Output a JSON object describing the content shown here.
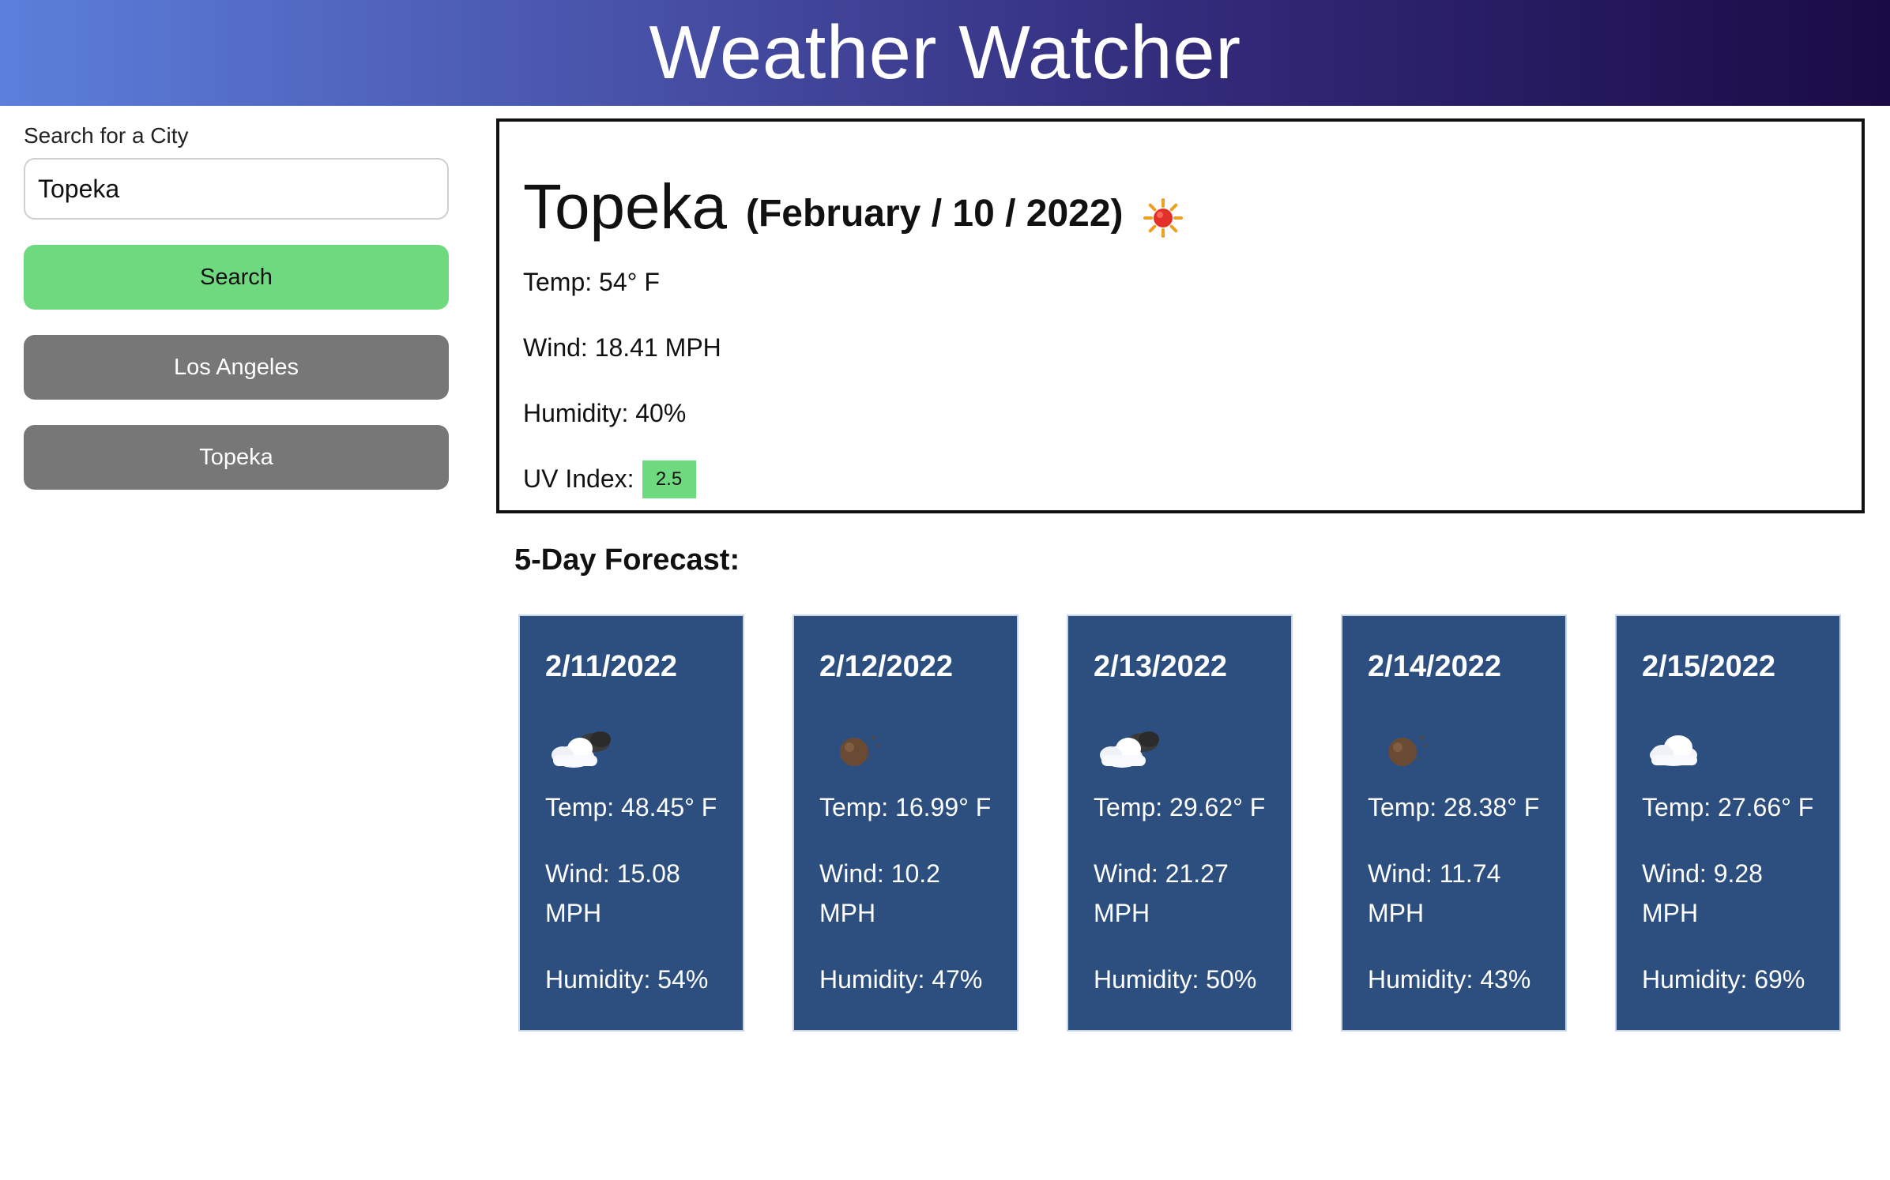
{
  "header": {
    "title": "Weather Watcher"
  },
  "sidebar": {
    "search_label": "Search for a City",
    "search_value": "Topeka",
    "search_button": "Search",
    "history": [
      "Los Angeles",
      "Topeka"
    ]
  },
  "current": {
    "city": "Topeka",
    "date": "(February / 10 / 2022)",
    "icon": "sun-icon",
    "temp": "Temp: 54° F",
    "wind": "Wind: 18.41 MPH",
    "humidity": "Humidity: 40%",
    "uv_label": "UV Index:",
    "uv_value": "2.5",
    "uv_color": "#6fd97f"
  },
  "forecast": {
    "title": "5-Day Forecast:",
    "days": [
      {
        "date": "2/11/2022",
        "icon": "partly-cloudy-night-icon",
        "temp": "Temp: 48.45° F",
        "wind": "Wind: 15.08 MPH",
        "humidity": "Humidity: 54%"
      },
      {
        "date": "2/12/2022",
        "icon": "clear-night-icon",
        "temp": "Temp: 16.99° F",
        "wind": "Wind: 10.2 MPH",
        "humidity": "Humidity: 47%"
      },
      {
        "date": "2/13/2022",
        "icon": "partly-cloudy-night-icon",
        "temp": "Temp: 29.62° F",
        "wind": "Wind: 21.27 MPH",
        "humidity": "Humidity: 50%"
      },
      {
        "date": "2/14/2022",
        "icon": "clear-night-icon",
        "temp": "Temp: 28.38° F",
        "wind": "Wind: 11.74 MPH",
        "humidity": "Humidity: 43%"
      },
      {
        "date": "2/15/2022",
        "icon": "cloud-icon",
        "temp": "Temp: 27.66° F",
        "wind": "Wind: 9.28 MPH",
        "humidity": "Humidity: 69%"
      }
    ]
  },
  "colors": {
    "header_gradient_start": "#5b7fdb",
    "header_gradient_end": "#1a0a45",
    "search_button": "#6fd97f",
    "history_button": "#777777",
    "forecast_card": "#2c4f7f"
  }
}
